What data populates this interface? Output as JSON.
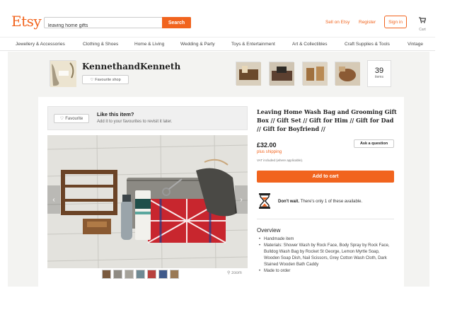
{
  "header": {
    "logo": "Etsy",
    "search_value": "leaving home gifts",
    "search_button": "Search",
    "sell_link": "Sell on Etsy",
    "register_link": "Register",
    "signin_button": "Sign in",
    "cart_label": "Cart",
    "accent_color": "#f1641e"
  },
  "categories": [
    "Jewellery & Accessories",
    "Clothing & Shoes",
    "Home & Living",
    "Wedding & Party",
    "Toys & Entertainment",
    "Art & Collectibles",
    "Craft Supplies & Tools",
    "Vintage"
  ],
  "shop": {
    "name": "KennethandKenneth",
    "favourite_button": "Favourite shop",
    "items_count": "39",
    "items_label": "items"
  },
  "like_prompt": {
    "favourite_button": "Favourite",
    "title": "Like this item?",
    "subtitle": "Add it to your favourites to revisit it later."
  },
  "gallery": {
    "zoom_label": "zoom",
    "thumb_count": 7
  },
  "listing": {
    "title": "Leaving Home Wash Bag and Grooming Gift Box // Gift Set // Gift for Him // Gift for Dad // Gift for Boyfriend //",
    "price": "£32.00",
    "shipping": "plus shipping",
    "vat": "VAT included (where applicable).",
    "ask_button": "Ask a question",
    "cart_button": "Add to cart",
    "scarcity_bold": "Don't wait.",
    "scarcity_text": " There's only 1 of these available.",
    "overview_heading": "Overview",
    "overview_items": [
      "Handmade item",
      "Materials: Shower Wash by Rock Face, Body Spray by Rock Face, Bulldog Wash Bag by Rocket St George, Lemon Myrtle Soap, Wooden Soap Dish, Nail Scissors, Grey Cotton Wash Cloth, Dark Stained Wooden Bath Caddy",
      "Made to order"
    ]
  }
}
